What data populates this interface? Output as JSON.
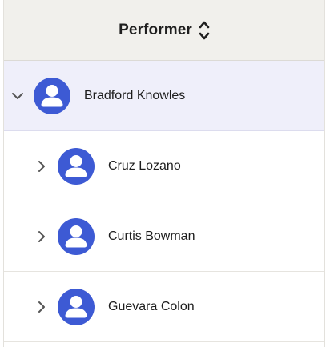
{
  "header": {
    "column_label": "Performer",
    "sort_icon": "sort-up-down-icon"
  },
  "rows": [
    {
      "name": "Bradford Knowles",
      "expanded": true,
      "level": 0,
      "icon": "user-avatar-icon"
    },
    {
      "name": "Cruz Lozano",
      "expanded": false,
      "level": 1,
      "icon": "user-avatar-icon"
    },
    {
      "name": "Curtis Bowman",
      "expanded": false,
      "level": 1,
      "icon": "user-avatar-icon"
    },
    {
      "name": "Guevara Colon",
      "expanded": false,
      "level": 1,
      "icon": "user-avatar-icon"
    }
  ],
  "colors": {
    "avatar": "#3d5ad4",
    "selected_row_bg": "#efeffa",
    "header_bg": "#f1f0ec"
  }
}
